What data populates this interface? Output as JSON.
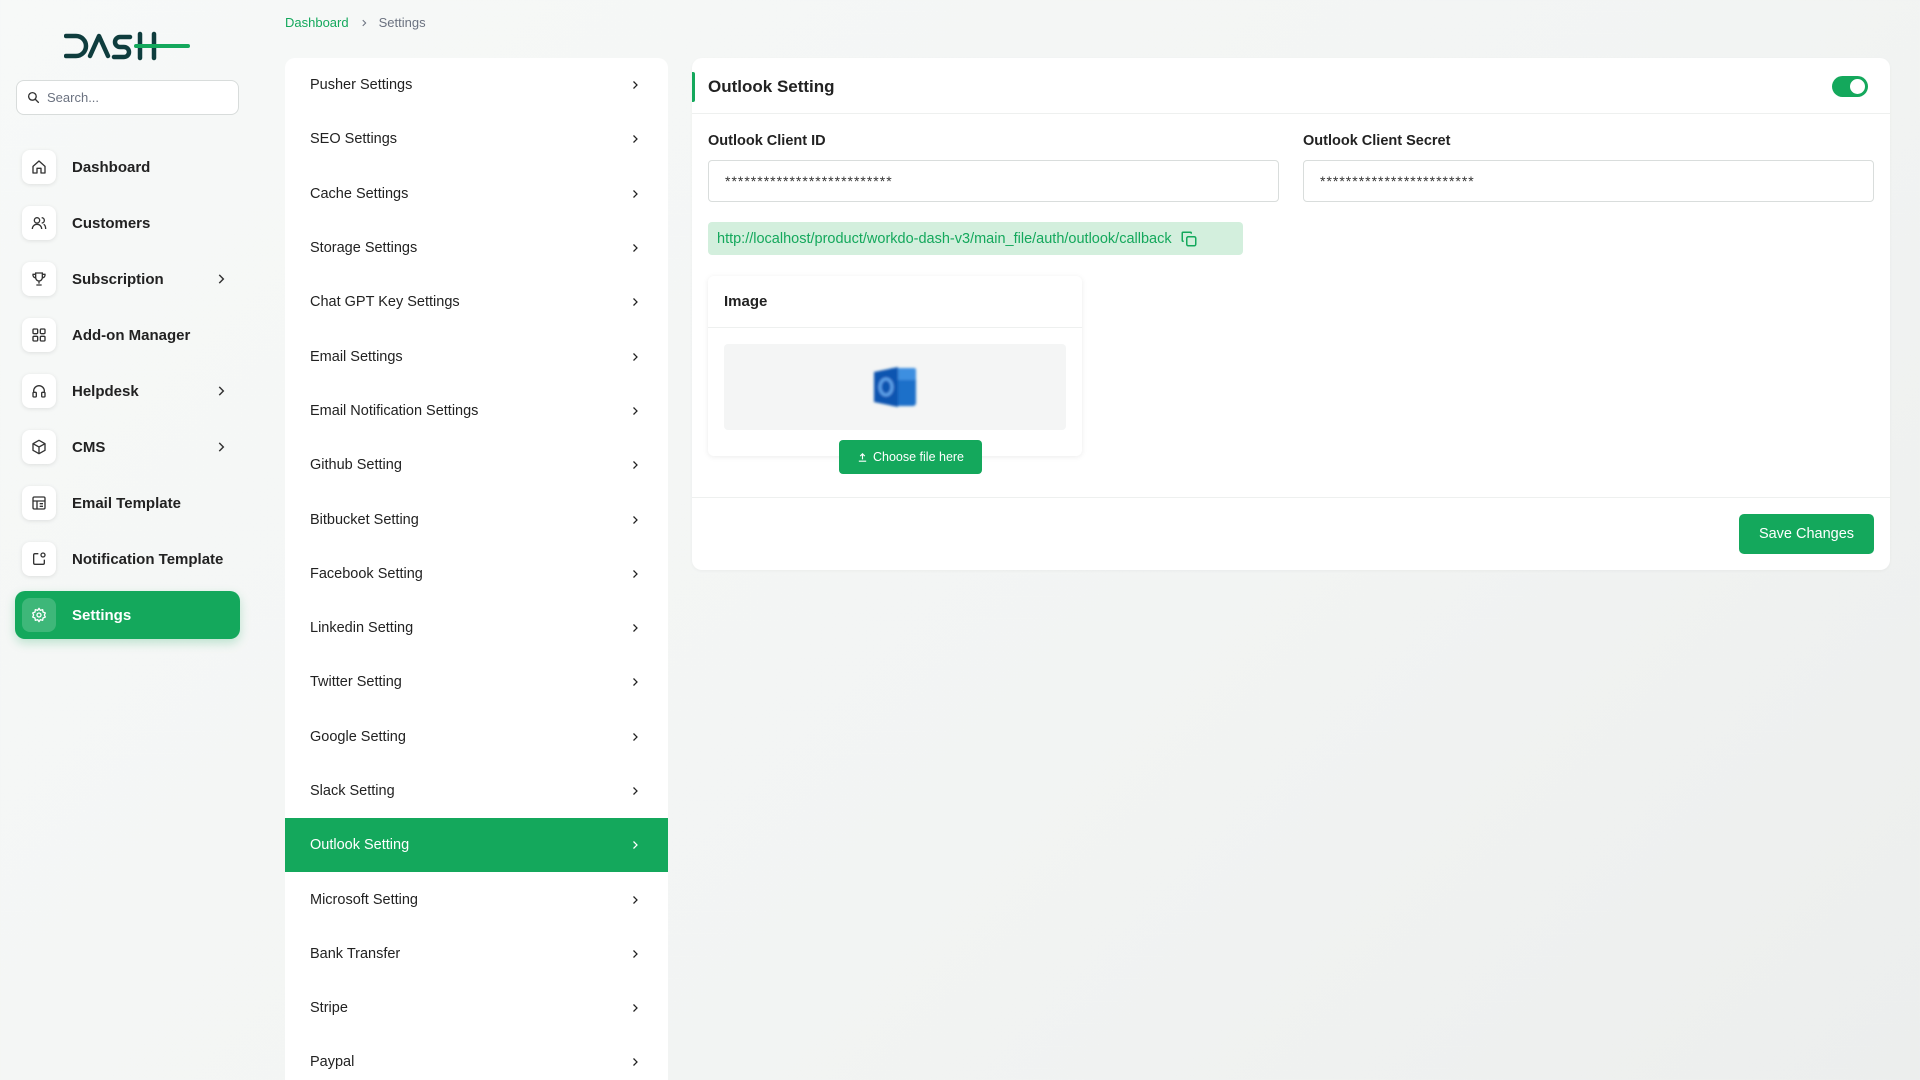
{
  "brand": {
    "logo_text": "DASH",
    "accent_color": "#14a85c"
  },
  "search": {
    "placeholder": "Search..."
  },
  "sidebar": {
    "items": [
      {
        "label": "Dashboard",
        "icon": "home-icon",
        "has_submenu": false,
        "active": false
      },
      {
        "label": "Customers",
        "icon": "users-icon",
        "has_submenu": false,
        "active": false
      },
      {
        "label": "Subscription",
        "icon": "trophy-icon",
        "has_submenu": true,
        "active": false
      },
      {
        "label": "Add-on Manager",
        "icon": "grid-icon",
        "has_submenu": false,
        "active": false
      },
      {
        "label": "Helpdesk",
        "icon": "headphones-icon",
        "has_submenu": true,
        "active": false
      },
      {
        "label": "CMS",
        "icon": "package-icon",
        "has_submenu": true,
        "active": false
      },
      {
        "label": "Email Template",
        "icon": "template-icon",
        "has_submenu": false,
        "active": false
      },
      {
        "label": "Notification Template",
        "icon": "notification-icon",
        "has_submenu": false,
        "active": false
      },
      {
        "label": "Settings",
        "icon": "gear-icon",
        "has_submenu": false,
        "active": true
      }
    ]
  },
  "breadcrumb": {
    "home": "Dashboard",
    "current": "Settings"
  },
  "settings_menu": {
    "items": [
      "Pusher Settings",
      "SEO Settings",
      "Cache Settings",
      "Storage Settings",
      "Chat GPT Key Settings",
      "Email Settings",
      "Email Notification Settings",
      "Github Setting",
      "Bitbucket Setting",
      "Facebook Setting",
      "Linkedin Setting",
      "Twitter Setting",
      "Google Setting",
      "Slack Setting",
      "Outlook Setting",
      "Microsoft Setting",
      "Bank Transfer",
      "Stripe",
      "Paypal"
    ],
    "active": "Outlook Setting"
  },
  "outlook": {
    "title": "Outlook Setting",
    "enabled": true,
    "client_id_label": "Outlook Client ID",
    "client_id_value": "**************************",
    "client_secret_label": "Outlook Client Secret",
    "client_secret_value": "************************",
    "callback_url": "http://localhost/product/workdo-dash-v3/main_file/auth/outlook/callback",
    "image_label": "Image",
    "choose_file_label": "Choose file here",
    "save_label": "Save Changes"
  }
}
